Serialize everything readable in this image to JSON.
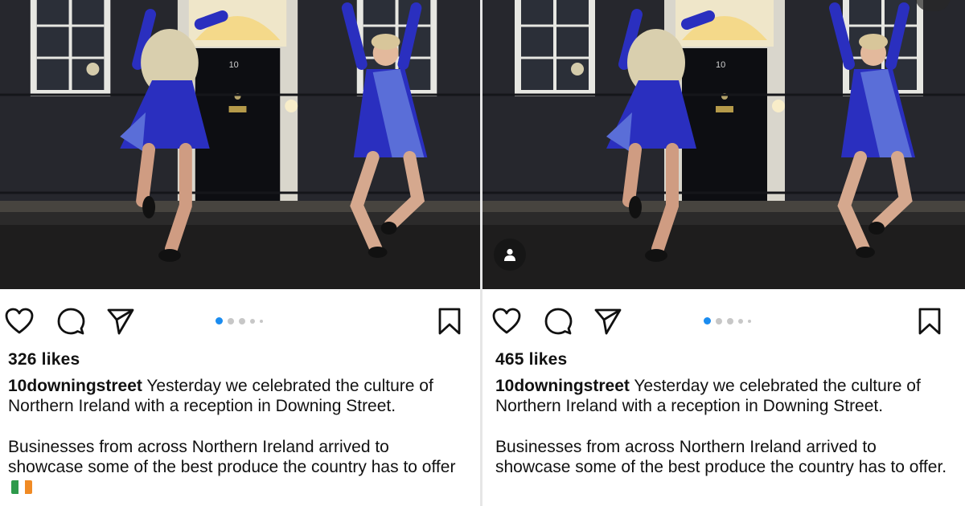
{
  "posts": [
    {
      "likes": "326 likes",
      "username": "10downingstreet",
      "caption_line1": "Yesterday we celebrated the culture of Northern Ireland with a reception in Downing Street.",
      "caption_line2": "Businesses from across Northern Ireland arrived to showcase some of the best produce the country has to offer",
      "emoji_icon": "ireland-flag-icon",
      "door_number": "10",
      "carousel": {
        "total": 5,
        "active": 1
      },
      "flag_colors": [
        "#2e9a4b",
        "#ffffff",
        "#f08a24"
      ]
    },
    {
      "likes": "465 likes",
      "username": "10downingstreet",
      "caption_line1": "Yesterday we celebrated the culture of Northern Ireland with a reception in Downing Street.",
      "caption_line2": "Businesses from across Northern Ireland arrived to showcase some of the best produce the country has to offer.",
      "door_number": "10",
      "carousel": {
        "total": 5,
        "active": 1
      },
      "tag_icon": "person-tag-icon"
    }
  ],
  "colors": {
    "carousel_active": "#1a8cf0",
    "carousel_inactive": "#c7c7c7",
    "dress": "#2a2fbf",
    "tartan": "#5a6ed8"
  },
  "icons": [
    "heart-icon",
    "comment-icon",
    "share-icon",
    "bookmark-icon"
  ]
}
